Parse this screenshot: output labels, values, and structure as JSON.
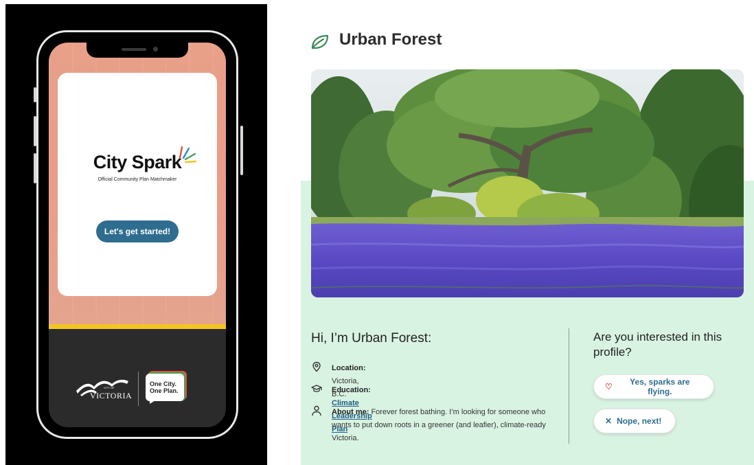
{
  "phone": {
    "brand_name": "City Spark",
    "brand_tagline": "Official Community Plan Matchmaker",
    "start_button": "Let's get started!",
    "city_of": "CITY OF",
    "city_name": "VICTORIA",
    "plan_badge_line1": "One City.",
    "plan_badge_line2": "One Plan.",
    "colors": {
      "start_button": "#2e6d8f",
      "accent_bar": "#f2c521",
      "backdrop": "#e99c87"
    }
  },
  "profile": {
    "title": "Urban Forest",
    "greeting": "Hi, I’m Urban Forest:",
    "location_label": "Location:",
    "location_value": "Victoria, B.C.",
    "education_label": "Education:",
    "education_value": "Climate Leadership Plan",
    "about_label": "About me:",
    "about_value": "Forever forest bathing. I’m looking for someone who wants to put down roots in a greener (and leafier), climate-ready Victoria.",
    "question": "Are you interested in this profile?",
    "yes_button": "Yes, sparks are flying.",
    "no_button": "Nope, next!",
    "icons": [
      "leaf-icon",
      "location-pin-icon",
      "graduation-cap-icon",
      "person-icon",
      "heart-icon",
      "close-icon"
    ],
    "colors": {
      "panel_bg": "#d9f3e2",
      "button_text": "#2e6d8f",
      "heart": "#d34b4b",
      "leaf": "#3c8a5a"
    }
  }
}
